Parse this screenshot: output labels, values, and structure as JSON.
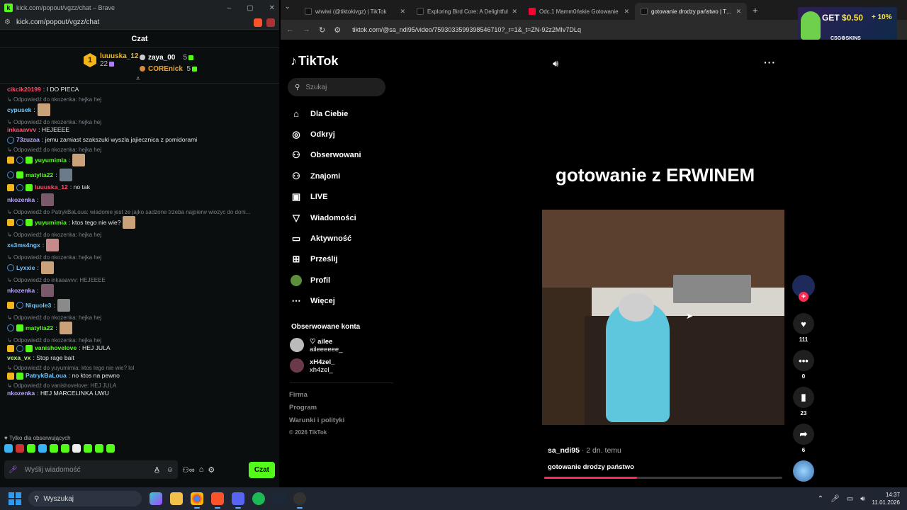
{
  "kick_window": {
    "title": "kick.com/popout/vgzz/chat – Brave",
    "url": "kick.com/popout/vgzz/chat",
    "window_controls": [
      "–",
      "▢",
      "✕"
    ],
    "chat_header": "Czat",
    "leaderboard": {
      "first": {
        "rank": "1",
        "name": "luuuska_12",
        "value": "22"
      },
      "second": {
        "name": "zaya_00",
        "value": "5"
      },
      "third": {
        "name": "COREnick",
        "value": "5"
      }
    },
    "messages": [
      {
        "user": "cikcik20199",
        "color": "#ff4d6d",
        "text": ": I DO PIECA"
      },
      {
        "reply": "Odpowiedź do nkozenka: hejka hej",
        "user": "cypusek",
        "color": "#6ec6ff",
        "text": ":",
        "emote": "#c9a27a"
      },
      {
        "reply": "Odpowiedź do nkozenka: hejka hej",
        "user": "inkaaavvv",
        "color": "#ff4d6d",
        "text": ": HEJEEEE"
      },
      {
        "user": "73zuzaa",
        "color": "#b9a7ff",
        "text": ": jemu zamiast szakszuki wyszla jajiecznica z pomidorami",
        "ring": true
      },
      {
        "reply": "Odpowiedź do nkozenka: hejka hej",
        "user": "yuyumimia",
        "color": "#53fc18",
        "text": ":",
        "emote": "#c9a27a",
        "crown": true,
        "ring": true,
        "gbadge": true
      },
      {
        "user": "matylia22",
        "color": "#53fc18",
        "text": ":",
        "emote": "#6b7b8a",
        "ring": true,
        "gbadge": true
      },
      {
        "user": "luuuska_12",
        "color": "#ff4d6d",
        "text": ": no tak",
        "crown": true,
        "ring": true,
        "gbadge": true
      },
      {
        "user": "nkozenka",
        "color": "#b9a7ff",
        "text": ":",
        "emote": "#7a5a6a"
      },
      {
        "reply": "Odpowiedź do PatrykBaLoua: wiadome jest ze jajko sadzone trzeba najpierw wiozyc do doni...",
        "user": "yuyumimia",
        "color": "#53fc18",
        "text": ": ktos tego nie wie?",
        "emote": "#c9a27a",
        "crown": true,
        "ring": true,
        "gbadge": true
      },
      {
        "reply": "Odpowiedź do nkozenka: hejka hej",
        "user": "xs3ms4ngx",
        "color": "#6ec6ff",
        "text": ":",
        "emote": "#c78a8a"
      },
      {
        "reply": "Odpowiedź do nkozenka: hejka hej",
        "user": "Lyxxie",
        "color": "#6ec6ff",
        "text": ":",
        "emote": "#c9a27a",
        "ring": true
      },
      {
        "reply": "Odpowiedź do inkaaavvv: HEJEEEE",
        "user": "nkozenka",
        "color": "#b9a7ff",
        "text": ":",
        "emote": "#7a5a6a"
      },
      {
        "user": "Niquole3",
        "color": "#6ec6ff",
        "text": ":",
        "emote": "#8a8a8a",
        "crown": true,
        "ring": true
      },
      {
        "reply": "Odpowiedź do nkozenka: hejka hej",
        "user": "matylia22",
        "color": "#53fc18",
        "text": ":",
        "emote": "#c9a27a",
        "ring": true,
        "gbadge": true
      },
      {
        "reply": "Odpowiedź do nkozenka: hejka hej",
        "user": "vanishovelove",
        "color": "#53fc18",
        "text": ": HEJ JULA",
        "crown": true,
        "ring": true,
        "gbadge": true
      },
      {
        "user": "vexa_vx",
        "color": "#b9f27a",
        "text": ": Stop rage bait"
      },
      {
        "reply": "Odpowiedź do yuyumimia: ktos tego nie wie? lol",
        "user": "PatrykBaLoua",
        "color": "#6ec6ff",
        "text": ": no ktos na pewno",
        "crown": true,
        "gbadge": true
      },
      {
        "reply": "Odpowiedź do vanishovelove: HEJ JULA",
        "user": "nkozenka",
        "color": "#b9a7ff",
        "text": ": HEJ MARCELINKA UWU"
      }
    ],
    "followers_only": "♥ Tylko dla obserwujących",
    "input_placeholder": "Wyślij wiadomość",
    "send_label": "Czat"
  },
  "browser": {
    "tabs": [
      {
        "title": "wiwiwi (@tiktokivgz) | TikTok",
        "icon_color": "#111"
      },
      {
        "title": "Exploring Bird Core: A Delightful",
        "icon_color": "#111"
      },
      {
        "title": "Odc.1 Mamm0ńskie Gotowanie",
        "icon_color": "#ff0033"
      },
      {
        "title": "gotowanie drodzy państwo | TikTok",
        "icon_color": "#111",
        "active": true
      }
    ],
    "url": "tiktok.com/@sa_ndi95/video/7593033599398546710?_r=1&_t=ZN-92z2MIv7DLq",
    "ad": {
      "get": "GET",
      "amount": "$0.50",
      "plus": "+ 10%",
      "brand": "CSG⚙SKINS"
    }
  },
  "tiktok": {
    "logo": "TikTok",
    "search_placeholder": "Szukaj",
    "nav": [
      {
        "label": "Dla Ciebie",
        "icon": "home-icon",
        "glyph": "⌂"
      },
      {
        "label": "Odkryj",
        "icon": "compass-icon",
        "glyph": "◎"
      },
      {
        "label": "Obserwowani",
        "icon": "following-icon",
        "glyph": "⚇"
      },
      {
        "label": "Znajomi",
        "icon": "friends-icon",
        "glyph": "⚇"
      },
      {
        "label": "LIVE",
        "icon": "live-icon",
        "glyph": "▣"
      },
      {
        "label": "Wiadomości",
        "icon": "messages-icon",
        "glyph": "▽"
      },
      {
        "label": "Aktywność",
        "icon": "activity-icon",
        "glyph": "▭"
      },
      {
        "label": "Prześlij",
        "icon": "upload-icon",
        "glyph": "⊞"
      },
      {
        "label": "Profil",
        "icon": "profile-icon",
        "glyph": ""
      },
      {
        "label": "Więcej",
        "icon": "more-icon",
        "glyph": "⋯"
      }
    ],
    "followed_title": "Obserwowane konta",
    "followed": [
      {
        "name": "♡ ailee",
        "handle": "aileeeeee_"
      },
      {
        "name": "xH4zel_",
        "handle": "xh4zel_"
      }
    ],
    "footer": [
      "Firma",
      "Program",
      "Warunki i polityki"
    ],
    "copyright": "© 2026 TikTok",
    "video_title": "gotowanie z ERWINEM",
    "author": "sa_ndi95",
    "time_ago": " · 2 dn. temu",
    "description": "gotowanie drodzy państwo",
    "progress": 0.39,
    "likes": "111",
    "comments": "0",
    "saves": "23",
    "shares": "6"
  },
  "taskbar": {
    "search": "Wyszukaj",
    "time": "14:37",
    "date": "11.01.2026"
  }
}
